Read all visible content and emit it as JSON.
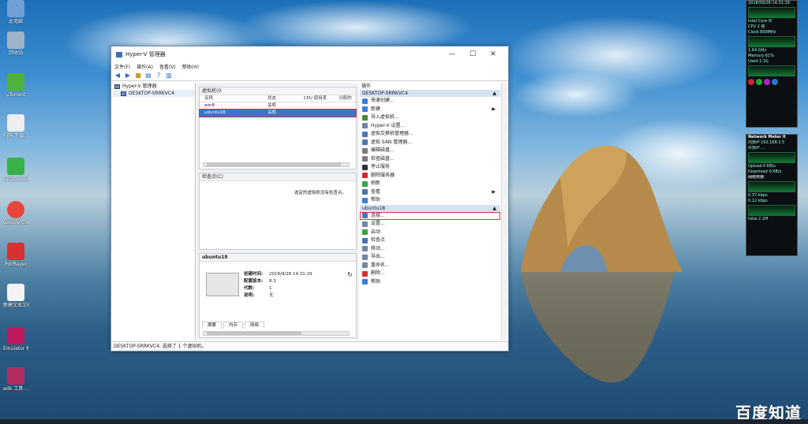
{
  "desktop": {
    "icons": [
      {
        "label": "此电脑",
        "color": "#6f9fd6"
      },
      {
        "label": "回收站",
        "color": "#9fb4c9"
      },
      {
        "label": "µTorrent",
        "color": "#4fb23c"
      },
      {
        "label": "扫码 下载...",
        "color": "#eeeeee"
      },
      {
        "label": "DiskGenius",
        "color": "#36b24a"
      },
      {
        "label": "Google Chrome",
        "color": "#e8453c"
      },
      {
        "label": "PotPlayer",
        "color": "#d93030"
      },
      {
        "label": "新建文本文档",
        "color": "#f4f4f4"
      },
      {
        "label": "Emulator 模拟器",
        "color": "#c0185e"
      },
      {
        "label": "adb 工具 ...",
        "color": "#b42d5f"
      }
    ],
    "watermark": "百度知道"
  },
  "widgets": {
    "lines": [
      "2018/09/28 14:31:29",
      "Intel Core i5",
      "CPU 2 核",
      "Clock 800MHz",
      "1.64 GHz",
      "Memory 61%",
      "Used 2.1G"
    ],
    "netmon_title": "Network Meter II",
    "netmon_lines": [
      "内部IP 192.168.1.5",
      "外部IP ...",
      "Upload 0 KB/s",
      "Download 0 KB/s",
      "网络用量:",
      "0.37 kbps",
      "0.12 kbps",
      "total 2.1M"
    ]
  },
  "window": {
    "title": "Hyper-V 管理器",
    "minimize": "—",
    "maximize": "☐",
    "close": "✕",
    "menu": [
      "文件(F)",
      "操作(A)",
      "查看(V)",
      "帮助(H)"
    ],
    "tree": {
      "root": "Hyper-V 管理器",
      "child": "DESKTOP-SRRKVC4"
    },
    "vm_panel": {
      "title": "虚拟机(I)",
      "columns": [
        "名称",
        "状态",
        "CPU 使用率",
        "分配的"
      ],
      "rows": [
        {
          "name": "win8",
          "state": "关机",
          "cpu": "",
          "mem": ""
        },
        {
          "name": "ubuntu18",
          "state": "关机",
          "cpu": "",
          "mem": ""
        }
      ]
    },
    "checkpoint_panel": {
      "title": "检查点(C)",
      "message": "选定的虚拟机没有检查点。"
    },
    "detail_panel": {
      "title": "ubuntu18",
      "fields": [
        {
          "label": "创建时间:",
          "value": "2018/9/28 14:31:29"
        },
        {
          "label": "配置版本:",
          "value": "8.3"
        },
        {
          "label": "代数:",
          "value": "1"
        },
        {
          "label": "说明:",
          "value": "无"
        }
      ],
      "tabs": [
        "摘要",
        "内存",
        "网络"
      ]
    },
    "actions": {
      "header": "操作",
      "host_section": "DESKTOP-SRRKVC4",
      "host_items": [
        {
          "label": "快速创建...",
          "color": "#3c7cd6"
        },
        {
          "label": "新建",
          "color": "#3c7cd6",
          "arrow": "▶"
        },
        {
          "label": "导入虚拟机...",
          "color": "#4a8a3a"
        },
        {
          "label": "Hyper-V 设置...",
          "color": "#6f86a6"
        },
        {
          "label": "虚拟交换机管理器...",
          "color": "#4a76b6"
        },
        {
          "label": "虚拟 SAN 管理器...",
          "color": "#4a76b6"
        },
        {
          "label": "编辑磁盘...",
          "color": "#7b7b7b"
        },
        {
          "label": "检查磁盘...",
          "color": "#7b7b7b"
        },
        {
          "label": "停止服务",
          "color": "#333333"
        },
        {
          "label": "删除服务器",
          "color": "#d62b2b"
        },
        {
          "label": "刷新",
          "color": "#3aa346"
        },
        {
          "label": "查看",
          "color": "#4a76b6",
          "arrow": "▶"
        },
        {
          "label": "帮助",
          "color": "#3c7cd6"
        }
      ],
      "vm_section": "ubuntu18",
      "vm_items": [
        {
          "label": "连接...",
          "color": "#4a76b6"
        },
        {
          "label": "设置...",
          "color": "#6f86a6"
        },
        {
          "label": "启动",
          "color": "#3aa346"
        },
        {
          "label": "检查点",
          "color": "#4a76b6"
        },
        {
          "label": "移动...",
          "color": "#6f86a6"
        },
        {
          "label": "导出...",
          "color": "#6f86a6"
        },
        {
          "label": "重命名...",
          "color": "#6f86a6"
        },
        {
          "label": "删除...",
          "color": "#d62b2b"
        },
        {
          "label": "帮助",
          "color": "#3c7cd6"
        }
      ],
      "collapse": "▲"
    },
    "status": "DESKTOP-SRRKVC4: 选择了 1 个虚拟机。"
  },
  "colors": {
    "selection": "#3b74cc",
    "highlight": "#d9343c",
    "section": "#d5e2ef"
  }
}
